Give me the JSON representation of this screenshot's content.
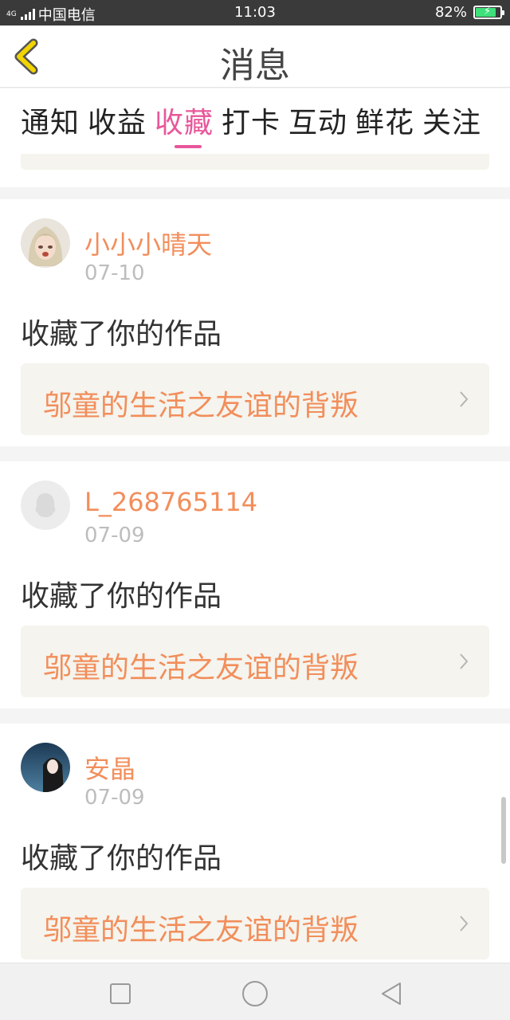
{
  "status": {
    "network": "4G",
    "carrier": "中国电信",
    "time": "11:03",
    "battery": "82%",
    "battery_level": 0.82
  },
  "header": {
    "title": "消息",
    "back_icon": "chevron-left-icon"
  },
  "tabs": [
    {
      "label": "通知",
      "active": false
    },
    {
      "label": "收益",
      "active": false
    },
    {
      "label": "收藏",
      "active": true
    },
    {
      "label": "打卡",
      "active": false
    },
    {
      "label": "互动",
      "active": false
    },
    {
      "label": "鲜花",
      "active": false
    },
    {
      "label": "关注",
      "active": false
    }
  ],
  "notifications": [
    {
      "username": "小小小晴天",
      "date": "07-10",
      "action": "收藏了你的作品",
      "work_title": "邬童的生活之友谊的背叛",
      "avatar": "anime-avatar"
    },
    {
      "username": "L_268765114",
      "date": "07-09",
      "action": "收藏了你的作品",
      "work_title": "邬童的生活之友谊的背叛",
      "avatar": "default-avatar"
    },
    {
      "username": "安晶",
      "date": "07-09",
      "action": "收藏了你的作品",
      "work_title": "邬童的生活之友谊的背叛",
      "avatar": "photo-avatar"
    }
  ],
  "colors": {
    "accent_pink": "#e8579a",
    "name_orange": "#f28e5b",
    "box_bg": "#f5f4ee",
    "back_yellow": "#f2d400"
  },
  "navbar": {
    "icons": [
      "square-icon",
      "circle-icon",
      "triangle-back-icon"
    ]
  }
}
